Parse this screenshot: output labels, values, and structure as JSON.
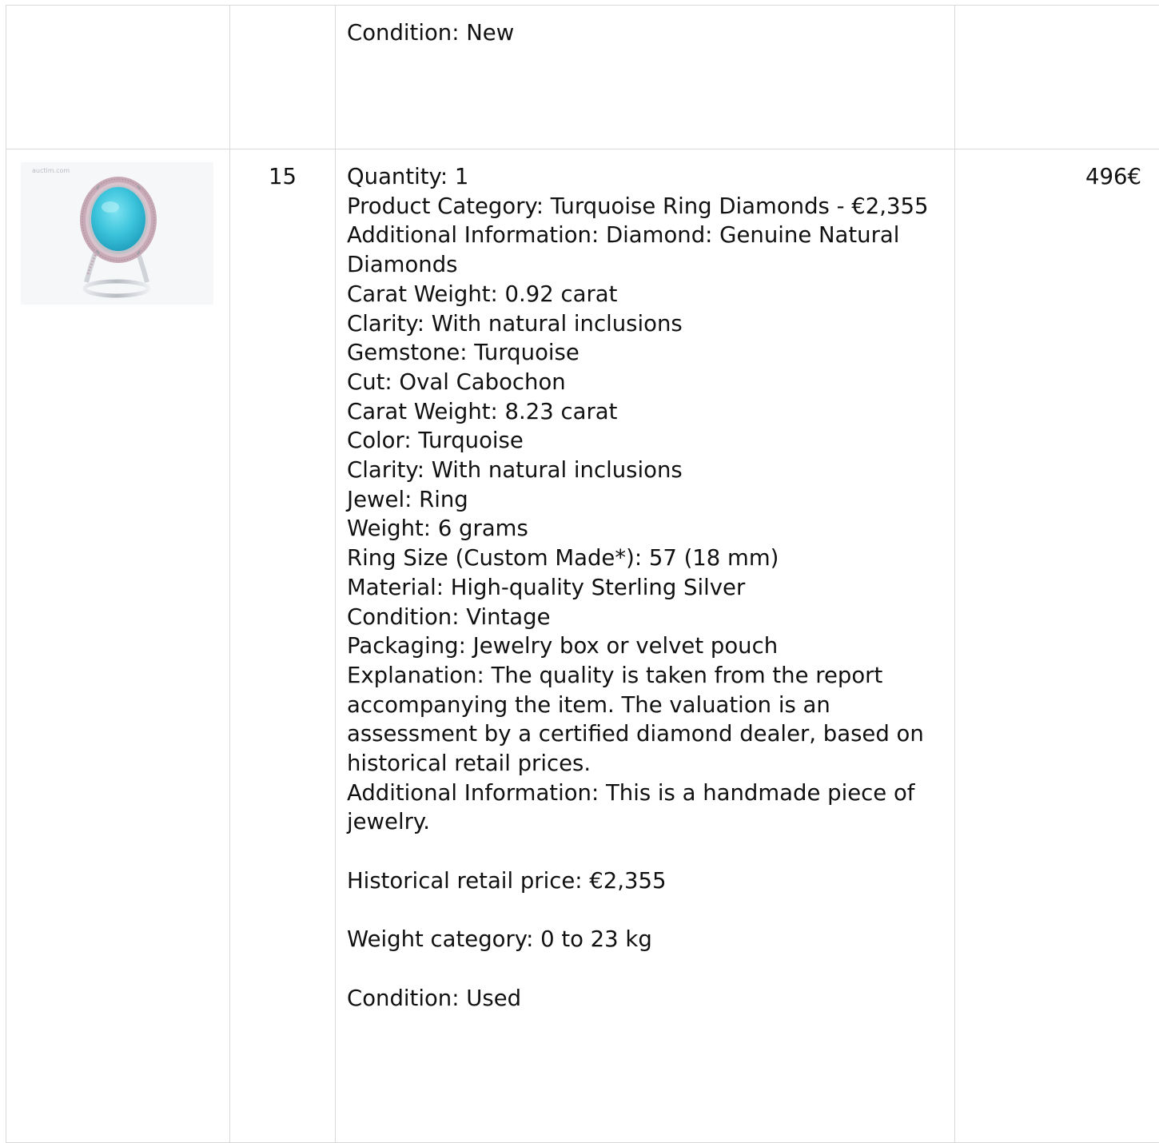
{
  "rows": [
    {
      "lot_number": "",
      "price": "",
      "description": [
        "Condition: New"
      ]
    },
    {
      "lot_number": "15",
      "price": "496€",
      "image_watermark": "auctim.com",
      "image_alt": "Turquoise ring with diamond halo",
      "colors": {
        "turquoise": "#3cc4dc",
        "metal": "#c9ccd1",
        "diamond_pave": "#c8a9b6"
      },
      "description": {
        "quantity": "Quantity: 1",
        "category": "Product Category: Turquoise Ring Diamonds - €2,355",
        "additional_1": "Additional Information: Diamond: Genuine Natural Diamonds",
        "carat_weight_1": "Carat Weight: 0.92 carat",
        "clarity_1": "Clarity: With natural inclusions",
        "gemstone": "Gemstone: Turquoise",
        "cut": "Cut: Oval Cabochon",
        "carat_weight_2": "Carat Weight: 8.23 carat",
        "color": "Color: Turquoise",
        "clarity_2": "Clarity: With natural inclusions",
        "jewel": "Jewel: Ring",
        "weight": "Weight: 6 grams",
        "ring_size": "Ring Size (Custom Made*): 57 (18 mm)",
        "material": "Material: High-quality Sterling Silver",
        "condition": "Condition: Vintage",
        "packaging": "Packaging: Jewelry box or velvet pouch",
        "explanation": "Explanation: The quality is taken from the report accompanying the item. The valuation is an assessment by a certified diamond dealer, based on historical retail prices.",
        "additional_2": "Additional Information: This is a handmade piece of jewelry.",
        "historical_price": "Historical retail price: €2,355",
        "weight_category": "Weight category: 0 to 23 kg",
        "condition_final": "Condition: Used"
      }
    }
  ]
}
